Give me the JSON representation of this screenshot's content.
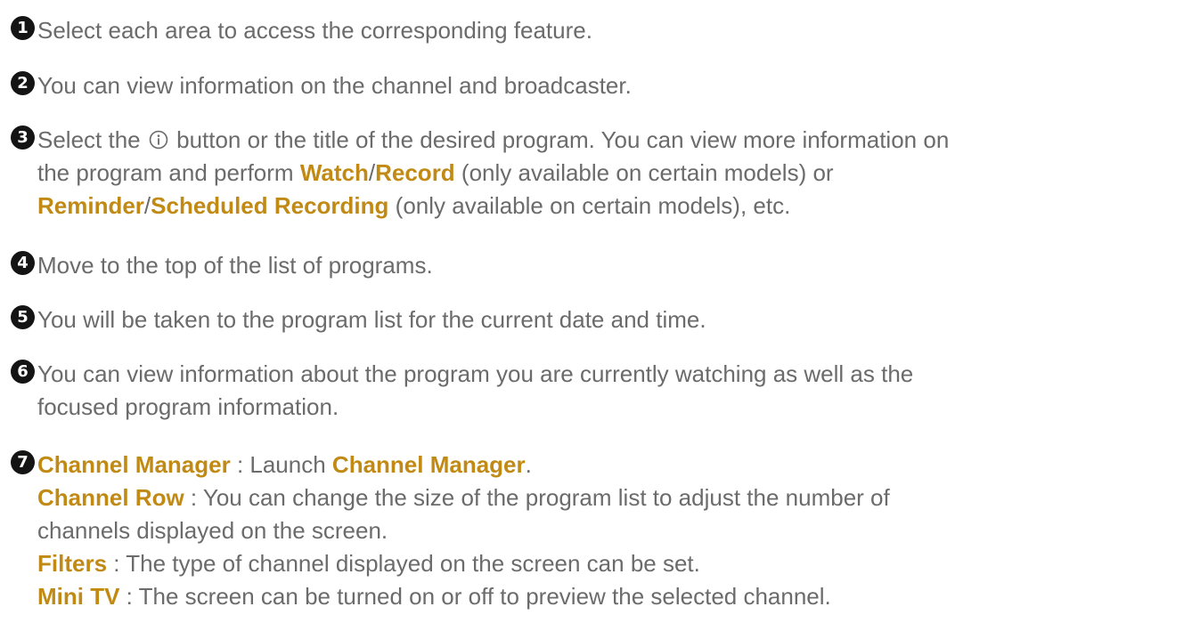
{
  "items": [
    {
      "number": "1",
      "text": "Select each area to access the corresponding feature."
    },
    {
      "number": "2",
      "text": "You can view information on the channel and broadcaster."
    },
    {
      "number": "3",
      "text_a": "Select the",
      "icon": "info-circle-icon",
      "text_b": "button or the title of the desired program. You can view more information on",
      "text_c": "the program and perform",
      "watch": "Watch",
      "slash1": "/",
      "record": "Record",
      "text_d": "(only available on certain models) or",
      "reminder": "Reminder",
      "slash2": "/",
      "scheduled": "Scheduled Recording",
      "text_e": "(only available on certain models), etc."
    },
    {
      "number": "4",
      "text": "Move to the top of the list of programs."
    },
    {
      "number": "5",
      "text": "You will be taken to the program list for the current date and time."
    },
    {
      "number": "6",
      "text_a": "You can view information about the program you are currently watching as well as the",
      "text_b": "focused program information."
    },
    {
      "number": "7",
      "channel_manager": "Channel Manager",
      "cm_sep": " : Launch ",
      "cm_target": "Channel Manager",
      "cm_end": ".",
      "channel_row": "Channel Row",
      "cr_text_a": " : You can change the size of the program list to adjust the number of",
      "cr_text_b": "channels displayed on the screen.",
      "filters": "Filters",
      "filters_text": " : The type of channel displayed on the screen can be set.",
      "mini_tv": "Mini TV",
      "mini_tv_text": " : The screen can be turned on or off to preview the selected channel."
    }
  ],
  "colors": {
    "text": "#6b6b6b",
    "highlight": "#c08a14",
    "badge": "#141414"
  }
}
